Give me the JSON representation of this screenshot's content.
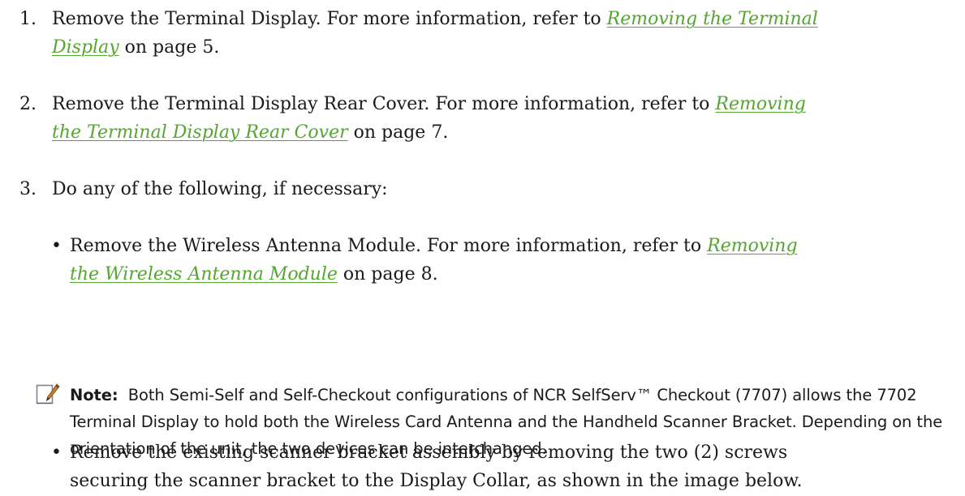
{
  "steps": [
    {
      "number": "1.",
      "text_before": "Remove the Terminal Display. For more information, refer to ",
      "link_line1": "Removing the Terminal",
      "link_line2": "Display",
      "text_after": " on page 5."
    },
    {
      "number": "2.",
      "text_before": "Remove the Terminal Display Rear Cover. For more information, refer to ",
      "link_line1": "Removing",
      "link_line2": "the Terminal Display Rear Cover",
      "text_after": " on page 7."
    },
    {
      "number": "3.",
      "text": "Do any of the following, if necessary:"
    }
  ],
  "bullets": [
    {
      "symbol": "•",
      "text_before": "Remove the Wireless Antenna Module. For more information, refer to ",
      "link_line1": "Removing",
      "link_line2": "the Wireless Antenna Module",
      "text_after": " on page 8."
    },
    {
      "symbol": "•",
      "line1": "Remove the existing scanner bracket assembly by removing the two (2) screws",
      "line2": "securing the scanner bracket to the Display Collar, as shown in the image below."
    }
  ],
  "note": {
    "icon": "note-pencil-icon",
    "label": "Note:",
    "text": "Both Semi-Self and Self-Checkout configurations of NCR SelfServ™ Checkout (7707) allows the 7702 Terminal Display to hold both the Wireless Card Antenna and the Handheld Scanner Bracket. Depending on the orientation of the unit, the two devices can be interchanged."
  }
}
